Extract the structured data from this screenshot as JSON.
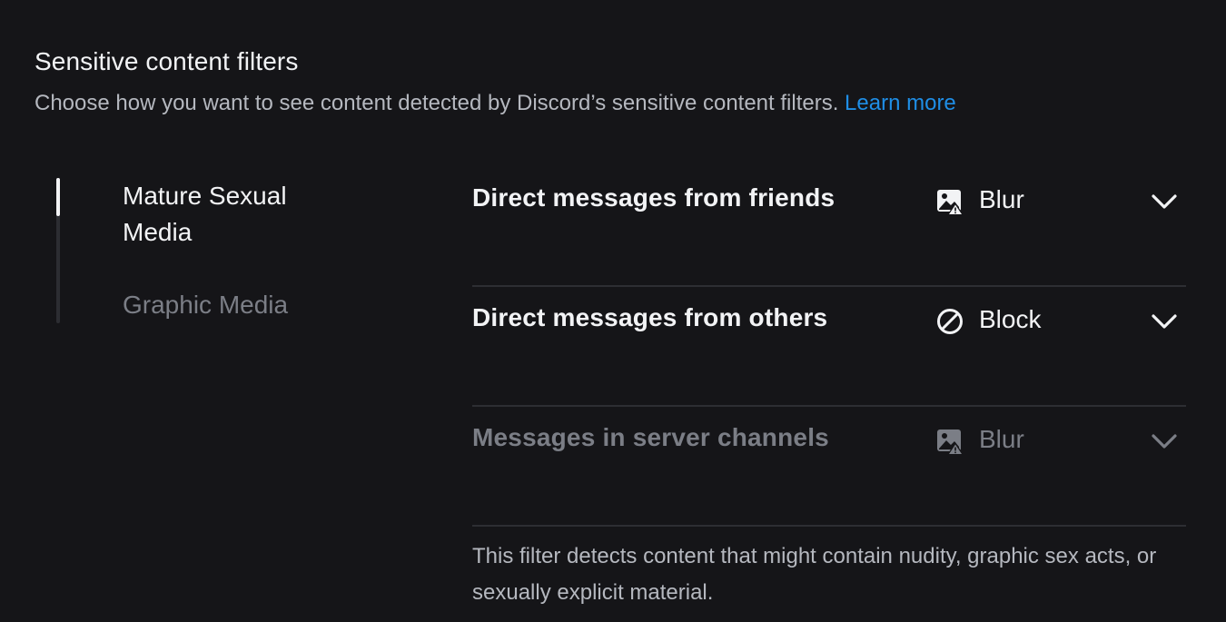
{
  "section": {
    "title": "Sensitive content filters",
    "description": "Choose how you want to see content detected by Discord’s sensitive content filters.",
    "learn_more": "Learn more"
  },
  "tabs": [
    {
      "label": "Mature Sexual Media",
      "active": true
    },
    {
      "label": "Graphic Media",
      "active": false
    }
  ],
  "rows": [
    {
      "label": "Direct messages from friends",
      "value": "Blur",
      "icon": "image-warning-icon",
      "enabled": true
    },
    {
      "label": "Direct messages from others",
      "value": "Block",
      "icon": "block-icon",
      "enabled": true
    },
    {
      "label": "Messages in server channels",
      "value": "Blur",
      "icon": "image-warning-icon",
      "enabled": false
    }
  ],
  "footnote": "This filter detects content that might contain nudity, graphic sex acts, or sexually explicit material.",
  "colors": {
    "background": "#151518",
    "text_primary": "#f2f3f5",
    "text_muted": "#b5b8bf",
    "text_disabled": "#7b7e86",
    "link": "#1f8ee6",
    "divider": "#2d2e33"
  }
}
